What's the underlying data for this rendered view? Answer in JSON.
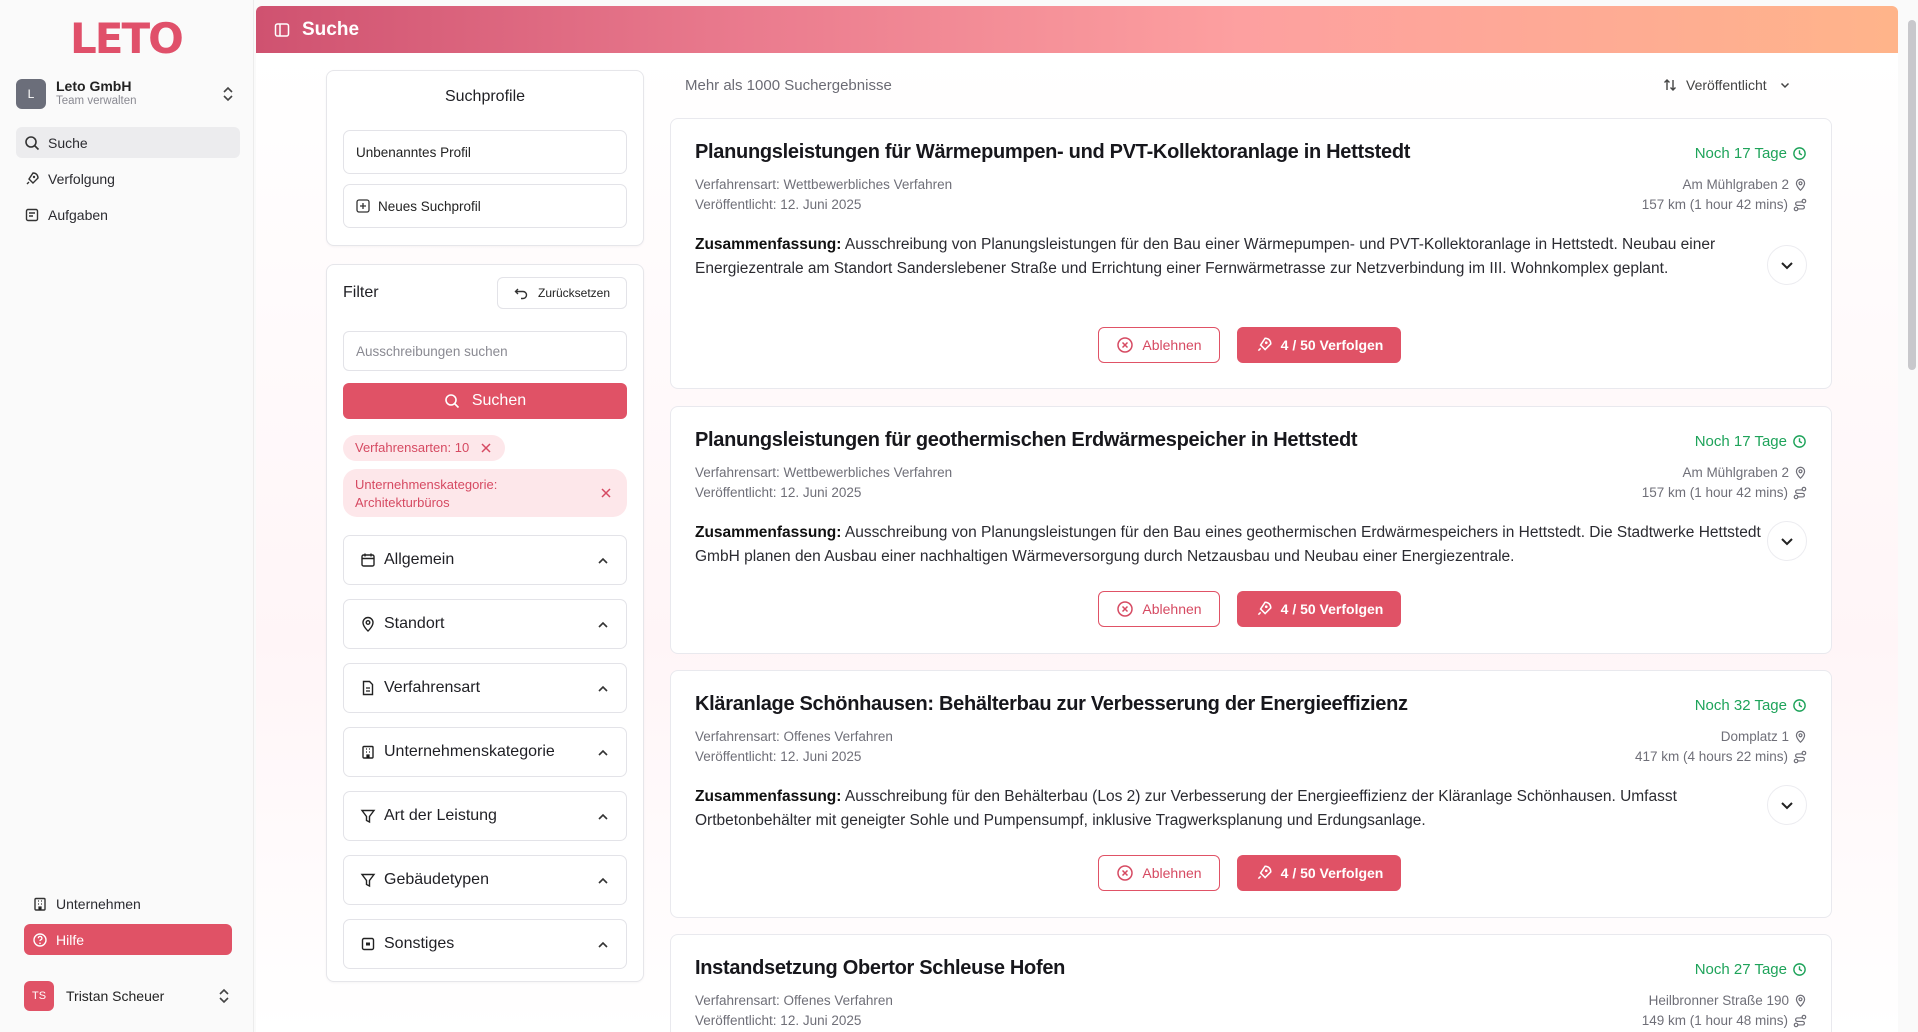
{
  "app": {
    "logo_text": "LETO",
    "brand_color": "#e05266"
  },
  "team": {
    "avatar": "L",
    "name": "Leto GmbH",
    "subtitle": "Team verwalten"
  },
  "nav": [
    {
      "label": "Suche",
      "icon": "search-icon",
      "active": true
    },
    {
      "label": "Verfolgung",
      "icon": "rocket-icon"
    },
    {
      "label": "Aufgaben",
      "icon": "tasks-icon"
    }
  ],
  "bottom_nav": {
    "company": "Unternehmen",
    "help": "Hilfe"
  },
  "user": {
    "initials": "TS",
    "name": "Tristan Scheuer"
  },
  "header": {
    "title": "Suche"
  },
  "profiles": {
    "title": "Suchprofile",
    "items": [
      "Unbenanntes Profil"
    ],
    "new_label": "Neues Suchprofil"
  },
  "filter": {
    "title": "Filter",
    "reset_label": "Zurücksetzen",
    "search_placeholder": "Ausschreibungen suchen",
    "search_button": "Suchen",
    "chips": [
      "Verfahrensarten: 10",
      "Unternehmenskategorie: Architekturbüros"
    ],
    "chip2_line1": "Unternehmenskategorie:",
    "chip2_line2": "Architekturbüros",
    "sections": [
      "Allgemein",
      "Standort",
      "Verfahrensart",
      "Unternehmenskategorie",
      "Art der Leistung",
      "Gebäudetypen",
      "Sonstiges"
    ]
  },
  "results": {
    "count_text": "Mehr als 1000 Suchergebnisse",
    "sort_label": "Veröffentlicht",
    "reject_label": "Ablehnen",
    "follow_label": "4 / 50 Verfolgen",
    "summary_prefix": "Zusammenfassung:",
    "items": [
      {
        "title": "Planungsleistungen für Wärmepumpen- und PVT-Kollektoranlage in Hettstedt",
        "due": "Noch 17 Tage",
        "procedure": "Verfahrensart: Wettbewerbliches Verfahren",
        "published": "Veröffentlicht: 12. Juni 2025",
        "address": "Am Mühlgraben 2",
        "distance": "157 km (1 hour 42 mins)",
        "summary": "Ausschreibung von Planungsleistungen für den Bau einer Wärmepumpen- und PVT-Kollektoranlage in Hettstedt. Neubau einer Energiezentrale am Standort Sanderslebener Straße und Errichtung einer Fernwärmetrasse zur Netzverbindung im III. Wohnkomplex geplant."
      },
      {
        "title": "Planungsleistungen für geothermischen Erdwärmespeicher in Hettstedt",
        "due": "Noch 17 Tage",
        "procedure": "Verfahrensart: Wettbewerbliches Verfahren",
        "published": "Veröffentlicht: 12. Juni 2025",
        "address": "Am Mühlgraben 2",
        "distance": "157 km (1 hour 42 mins)",
        "summary": "Ausschreibung von Planungsleistungen für den Bau eines geothermischen Erdwärmespeichers in Hettstedt. Die Stadtwerke Hettstedt GmbH planen den Ausbau einer nachhaltigen Wärmeversorgung durch Netzausbau und Neubau einer Energiezentrale."
      },
      {
        "title": "Kläranlage Schönhausen: Behälterbau zur Verbesserung der Energieeffizienz",
        "due": "Noch 32 Tage",
        "procedure": "Verfahrensart: Offenes Verfahren",
        "published": "Veröffentlicht: 12. Juni 2025",
        "address": "Domplatz 1",
        "distance": "417 km (4 hours 22 mins)",
        "summary": "Ausschreibung für den Behälterbau (Los 2) zur Verbesserung der Energieeffizienz der Kläranlage Schönhausen. Umfasst Ortbetonbehälter mit geneigter Sohle und Pumpensumpf, inklusive Tragwerksplanung und Erdungsanlage."
      },
      {
        "title": "Instandsetzung Obertor Schleuse Hofen",
        "due": "Noch 27 Tage",
        "procedure": "Verfahrensart: Offenes Verfahren",
        "published": "Veröffentlicht: 12. Juni 2025",
        "address": "Heilbronner Straße 190",
        "distance": "149 km (1 hour 48 mins)"
      }
    ]
  },
  "colors": {
    "accent": "#e05266",
    "due_green": "#1ea35a"
  }
}
